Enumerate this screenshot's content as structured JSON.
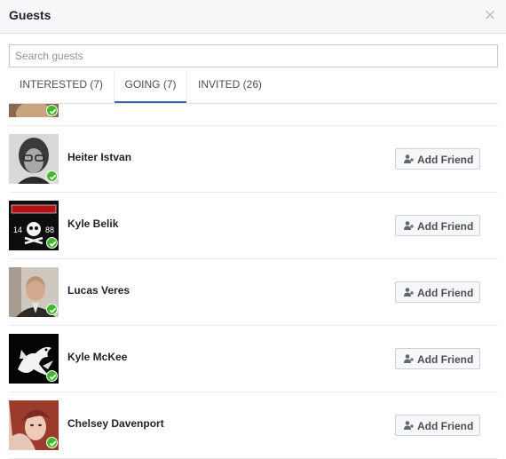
{
  "dialog": {
    "title": "Guests",
    "close_icon": "close-icon"
  },
  "search": {
    "placeholder": "Search guests",
    "value": ""
  },
  "tabs": [
    {
      "label": "INTERESTED (7)",
      "active": false
    },
    {
      "label": "GOING (7)",
      "active": true
    },
    {
      "label": "INVITED (26)",
      "active": false
    }
  ],
  "guests": [
    {
      "name": "",
      "button": "",
      "avatar": "partial-portrait",
      "going": true
    },
    {
      "name": "Heiter Istvan",
      "button": "Add Friend",
      "avatar": "vintage-portrait",
      "going": true
    },
    {
      "name": "Kyle Belik",
      "button": "Add Friend",
      "avatar": "skull-flag",
      "going": true
    },
    {
      "name": "Lucas Veres",
      "button": "Add Friend",
      "avatar": "man-portrait",
      "going": true
    },
    {
      "name": "Kyle McKee",
      "button": "Add Friend",
      "avatar": "dragon-emblem",
      "going": true
    },
    {
      "name": "Chelsey Davenport",
      "button": "Add Friend",
      "avatar": "woman-portrait",
      "going": true
    }
  ],
  "colors": {
    "accent": "#4267b2",
    "check": "#42b72a",
    "header_bg": "#f6f7f9"
  }
}
